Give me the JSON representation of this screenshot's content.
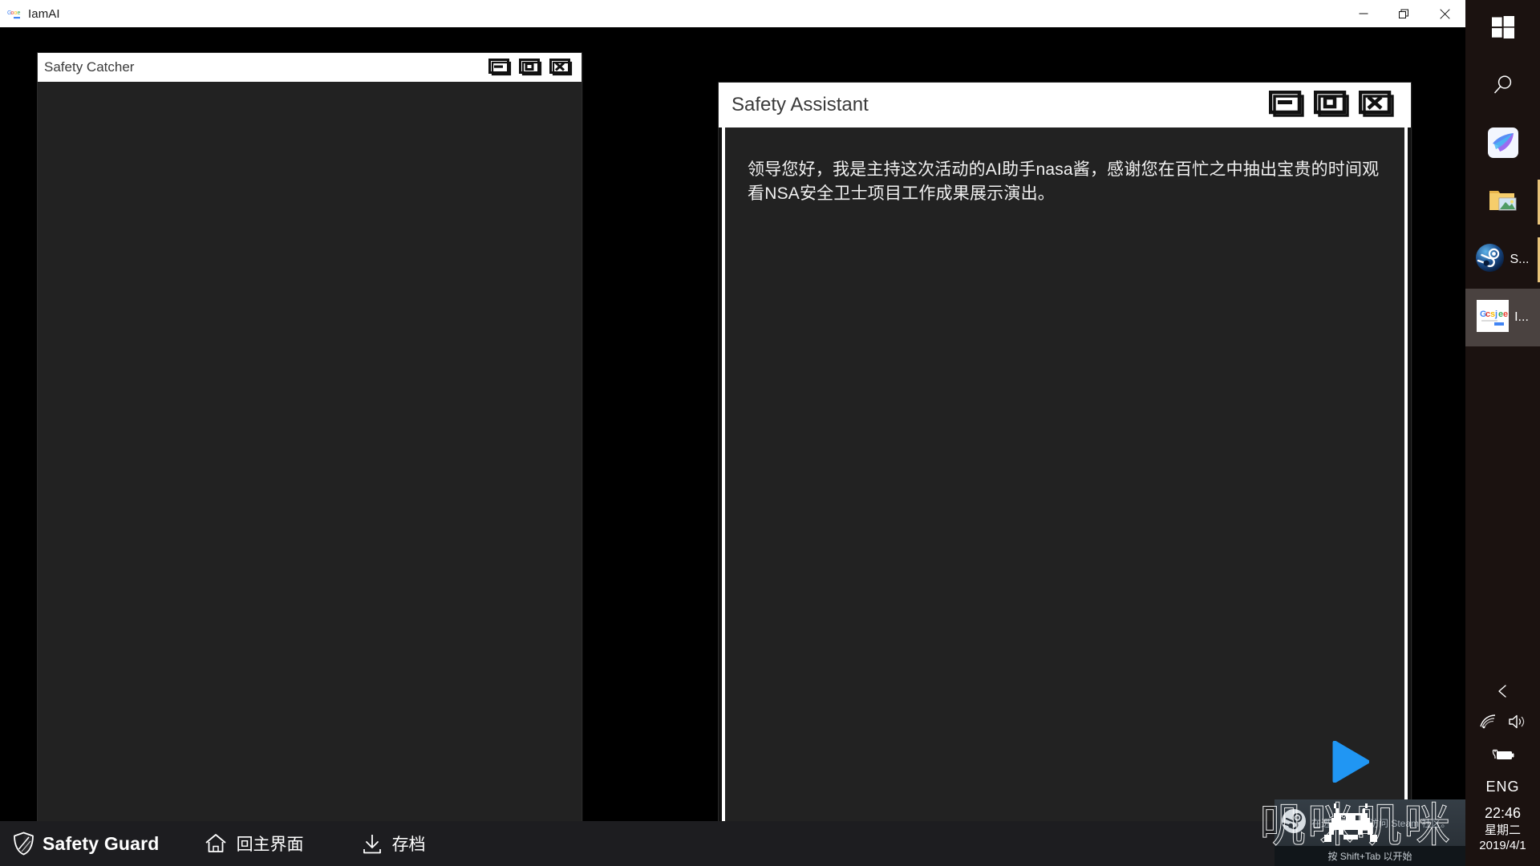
{
  "window": {
    "title": "IamAI",
    "icon": "google-colored-icon",
    "controls": {
      "minimize": "minimize-icon",
      "restore": "restore-icon",
      "close": "close-icon"
    }
  },
  "catcher_window": {
    "title": "Safety Catcher",
    "controls": {
      "minimize": "minimize-icon",
      "maximize": "maximize-icon",
      "close": "close-icon"
    }
  },
  "assistant_window": {
    "title": "Safety Assistant",
    "controls": {
      "minimize": "minimize-icon",
      "maximize": "maximize-icon",
      "close": "close-icon"
    },
    "dialogue": "领导您好，我是主持这次活动的AI助手nasa酱，感谢您在百忙之中抽出宝贵的时间观看NSA安全卫士项目工作成果展示演出。",
    "play_icon": "play-triangle-icon",
    "play_color": "#2096f3"
  },
  "hud": {
    "brand_icon": "shield-icon",
    "brand_label": "Safety Guard",
    "home_icon": "home-icon",
    "home_label": "回主界面",
    "save_icon": "download-save-icon",
    "save_label": "存档",
    "background": "#1d1d20"
  },
  "taskbar": {
    "background": "#1b1210",
    "items": [
      {
        "name": "start-button",
        "icon": "windows-logo-icon",
        "label": "",
        "state": "idle"
      },
      {
        "name": "search-button",
        "icon": "search-icon",
        "label": "",
        "state": "idle"
      },
      {
        "name": "bird-app-button",
        "icon": "blue-bird-icon",
        "label": "",
        "state": "idle"
      },
      {
        "name": "pictures-folder",
        "icon": "folder-picture-icon",
        "label": "",
        "state": "running"
      },
      {
        "name": "steam-app",
        "icon": "steam-icon",
        "label": "S...",
        "state": "running"
      },
      {
        "name": "iamai-app",
        "icon": "google-colored-icon",
        "label": "I...",
        "state": "active"
      }
    ],
    "tray": {
      "chevron": "chevron-up-icon",
      "network": "wifi-icon",
      "volume": "speaker-icon",
      "battery": "battery-charging-icon",
      "language": "ENG",
      "time": "22:46",
      "day": "星期二",
      "date": "2019/4/1"
    }
  },
  "steam_overlay": {
    "logo_icon": "steam-logo-icon",
    "invader_icon": "space-invader-icon",
    "message": "在进行游戏时访问 Steam 社区。",
    "hint": "按 Shift+Tab 以开始"
  },
  "watermark": {
    "text": "叽咪叽咪"
  }
}
